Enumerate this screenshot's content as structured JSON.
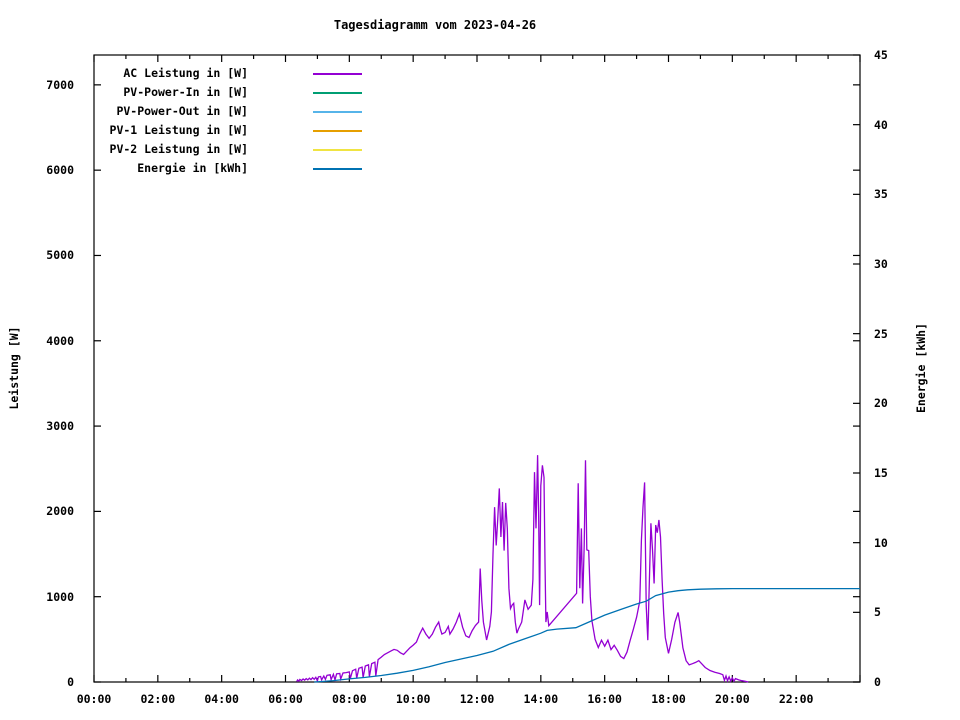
{
  "title": "Tagesdiagramm vom 2023-04-26",
  "chart_data": {
    "type": "line",
    "title": "Tagesdiagramm vom 2023-04-26",
    "grid": false,
    "legend_position": "top-left",
    "x_axis": {
      "unit": "time of day",
      "range_hours": [
        0,
        24
      ],
      "major_tick_every_hours": 2,
      "minor_tick_every_hours": 1,
      "tick_labels": [
        "00:00",
        "02:00",
        "04:00",
        "06:00",
        "08:00",
        "10:00",
        "12:00",
        "14:00",
        "16:00",
        "18:00",
        "20:00",
        "22:00"
      ]
    },
    "y_left_axis": {
      "label": "Leistung [W]",
      "range": [
        0,
        7350
      ],
      "ticks": [
        0,
        1000,
        2000,
        3000,
        4000,
        5000,
        6000,
        7000
      ],
      "tick_labels": [
        "0",
        "1000",
        "2000",
        "3000",
        "4000",
        "5000",
        "6000",
        "7000"
      ]
    },
    "y_right_axis": {
      "label": "Energie [kWh]",
      "range": [
        0,
        45
      ],
      "ticks": [
        0,
        5,
        10,
        15,
        20,
        25,
        30,
        35,
        40,
        45
      ],
      "tick_labels": [
        "0",
        "5",
        "10",
        "15",
        "20",
        "25",
        "30",
        "35",
        "40",
        "45"
      ]
    },
    "series": [
      {
        "name": "AC Leistung in [W]",
        "color": "#9400d3",
        "axis": "left",
        "points": [
          [
            6.35,
            5
          ],
          [
            6.38,
            25
          ],
          [
            6.42,
            10
          ],
          [
            6.45,
            30
          ],
          [
            6.5,
            18
          ],
          [
            6.55,
            35
          ],
          [
            6.6,
            22
          ],
          [
            6.65,
            40
          ],
          [
            6.7,
            25
          ],
          [
            6.75,
            45
          ],
          [
            6.8,
            28
          ],
          [
            6.85,
            50
          ],
          [
            6.9,
            32
          ],
          [
            6.95,
            55
          ],
          [
            7.0,
            15
          ],
          [
            7.03,
            60
          ],
          [
            7.1,
            65
          ],
          [
            7.13,
            25
          ],
          [
            7.2,
            70
          ],
          [
            7.25,
            30
          ],
          [
            7.3,
            78
          ],
          [
            7.4,
            85
          ],
          [
            7.43,
            28
          ],
          [
            7.5,
            90
          ],
          [
            7.55,
            25
          ],
          [
            7.6,
            95
          ],
          [
            7.7,
            100
          ],
          [
            7.73,
            35
          ],
          [
            7.8,
            105
          ],
          [
            7.9,
            110
          ],
          [
            8.0,
            118
          ],
          [
            8.03,
            40
          ],
          [
            8.1,
            132
          ],
          [
            8.2,
            150
          ],
          [
            8.23,
            45
          ],
          [
            8.3,
            162
          ],
          [
            8.4,
            175
          ],
          [
            8.43,
            52
          ],
          [
            8.5,
            188
          ],
          [
            8.6,
            202
          ],
          [
            8.63,
            62
          ],
          [
            8.7,
            216
          ],
          [
            8.8,
            232
          ],
          [
            8.83,
            72
          ],
          [
            8.9,
            262
          ],
          [
            9.0,
            292
          ],
          [
            9.1,
            322
          ],
          [
            9.2,
            342
          ],
          [
            9.3,
            362
          ],
          [
            9.4,
            382
          ],
          [
            9.5,
            372
          ],
          [
            9.6,
            342
          ],
          [
            9.7,
            322
          ],
          [
            9.8,
            362
          ],
          [
            9.9,
            402
          ],
          [
            10.0,
            432
          ],
          [
            10.1,
            468
          ],
          [
            10.2,
            560
          ],
          [
            10.3,
            632
          ],
          [
            10.4,
            562
          ],
          [
            10.5,
            512
          ],
          [
            10.6,
            562
          ],
          [
            10.7,
            642
          ],
          [
            10.8,
            702
          ],
          [
            10.85,
            622
          ],
          [
            10.9,
            562
          ],
          [
            11.0,
            582
          ],
          [
            11.1,
            652
          ],
          [
            11.15,
            562
          ],
          [
            11.25,
            622
          ],
          [
            11.35,
            702
          ],
          [
            11.45,
            800
          ],
          [
            11.55,
            642
          ],
          [
            11.65,
            542
          ],
          [
            11.75,
            522
          ],
          [
            11.85,
            602
          ],
          [
            11.95,
            662
          ],
          [
            12.05,
            702
          ],
          [
            12.1,
            1330
          ],
          [
            12.15,
            952
          ],
          [
            12.2,
            702
          ],
          [
            12.3,
            492
          ],
          [
            12.4,
            652
          ],
          [
            12.45,
            822
          ],
          [
            12.5,
            1500
          ],
          [
            12.55,
            2050
          ],
          [
            12.6,
            1600
          ],
          [
            12.65,
            1900
          ],
          [
            12.7,
            2270
          ],
          [
            12.75,
            1700
          ],
          [
            12.8,
            2110
          ],
          [
            12.85,
            1540
          ],
          [
            12.9,
            2100
          ],
          [
            12.95,
            1800
          ],
          [
            13.0,
            1100
          ],
          [
            13.05,
            862
          ],
          [
            13.1,
            902
          ],
          [
            13.15,
            922
          ],
          [
            13.2,
            702
          ],
          [
            13.25,
            572
          ],
          [
            13.3,
            622
          ],
          [
            13.4,
            702
          ],
          [
            13.5,
            962
          ],
          [
            13.6,
            852
          ],
          [
            13.7,
            902
          ],
          [
            13.75,
            1200
          ],
          [
            13.8,
            2460
          ],
          [
            13.85,
            1800
          ],
          [
            13.9,
            2660
          ],
          [
            13.93,
            2000
          ],
          [
            13.96,
            902
          ],
          [
            14.0,
            2300
          ],
          [
            14.05,
            2540
          ],
          [
            14.1,
            2400
          ],
          [
            14.13,
            1400
          ],
          [
            14.16,
            702
          ],
          [
            14.2,
            822
          ],
          [
            14.25,
            660
          ],
          [
            15.12,
            1040
          ],
          [
            15.17,
            2330
          ],
          [
            15.22,
            1100
          ],
          [
            15.27,
            1800
          ],
          [
            15.31,
            920
          ],
          [
            15.36,
            1600
          ],
          [
            15.4,
            2600
          ],
          [
            15.44,
            1550
          ],
          [
            15.5,
            1540
          ],
          [
            15.55,
            1000
          ],
          [
            15.6,
            720
          ],
          [
            15.7,
            500
          ],
          [
            15.8,
            405
          ],
          [
            15.9,
            490
          ],
          [
            16.0,
            420
          ],
          [
            16.1,
            490
          ],
          [
            16.2,
            380
          ],
          [
            16.3,
            430
          ],
          [
            16.4,
            370
          ],
          [
            16.5,
            300
          ],
          [
            16.6,
            275
          ],
          [
            16.7,
            350
          ],
          [
            16.8,
            490
          ],
          [
            16.9,
            620
          ],
          [
            17.0,
            760
          ],
          [
            17.1,
            950
          ],
          [
            17.15,
            1660
          ],
          [
            17.2,
            2050
          ],
          [
            17.25,
            2340
          ],
          [
            17.3,
            900
          ],
          [
            17.35,
            490
          ],
          [
            17.4,
            1200
          ],
          [
            17.45,
            1860
          ],
          [
            17.5,
            1550
          ],
          [
            17.55,
            1155
          ],
          [
            17.6,
            1840
          ],
          [
            17.65,
            1750
          ],
          [
            17.7,
            1900
          ],
          [
            17.75,
            1700
          ],
          [
            17.8,
            1200
          ],
          [
            17.85,
            800
          ],
          [
            17.9,
            520
          ],
          [
            18.0,
            335
          ],
          [
            18.1,
            500
          ],
          [
            18.2,
            700
          ],
          [
            18.3,
            815
          ],
          [
            18.35,
            700
          ],
          [
            18.45,
            400
          ],
          [
            18.55,
            250
          ],
          [
            18.65,
            200
          ],
          [
            18.75,
            215
          ],
          [
            18.85,
            230
          ],
          [
            18.95,
            250
          ],
          [
            19.05,
            210
          ],
          [
            19.15,
            170
          ],
          [
            19.3,
            135
          ],
          [
            19.45,
            115
          ],
          [
            19.6,
            100
          ],
          [
            19.7,
            85
          ],
          [
            19.75,
            20
          ],
          [
            19.8,
            70
          ],
          [
            19.85,
            15
          ],
          [
            19.9,
            60
          ],
          [
            19.95,
            12
          ],
          [
            20.0,
            50
          ],
          [
            20.05,
            10
          ],
          [
            20.1,
            40
          ],
          [
            20.2,
            25
          ],
          [
            20.3,
            15
          ],
          [
            20.4,
            8
          ],
          [
            20.5,
            0
          ]
        ]
      },
      {
        "name": "PV-Power-In in [W]",
        "color": "#009e73",
        "axis": "left",
        "points": []
      },
      {
        "name": "PV-Power-Out in [W]",
        "color": "#56b4e9",
        "axis": "left",
        "points": []
      },
      {
        "name": "PV-1 Leistung in [W]",
        "color": "#e69f00",
        "axis": "left",
        "points": []
      },
      {
        "name": "PV-2 Leistung in [W]",
        "color": "#f0e442",
        "axis": "left",
        "points": []
      },
      {
        "name": "Energie in [kWh]",
        "color": "#0072b2",
        "axis": "right",
        "points": [
          [
            6.9,
            0
          ],
          [
            7.2,
            0.04
          ],
          [
            7.5,
            0.1
          ],
          [
            8.0,
            0.22
          ],
          [
            8.5,
            0.33
          ],
          [
            9.0,
            0.47
          ],
          [
            9.5,
            0.63
          ],
          [
            10.0,
            0.83
          ],
          [
            10.5,
            1.1
          ],
          [
            11.0,
            1.4
          ],
          [
            11.5,
            1.65
          ],
          [
            12.0,
            1.9
          ],
          [
            12.5,
            2.2
          ],
          [
            13.0,
            2.7
          ],
          [
            13.5,
            3.1
          ],
          [
            14.0,
            3.5
          ],
          [
            14.2,
            3.7
          ],
          [
            14.5,
            3.8
          ],
          [
            15.1,
            3.9
          ],
          [
            15.5,
            4.3
          ],
          [
            16.0,
            4.8
          ],
          [
            16.5,
            5.2
          ],
          [
            17.0,
            5.6
          ],
          [
            17.3,
            5.8
          ],
          [
            17.6,
            6.2
          ],
          [
            18.0,
            6.45
          ],
          [
            18.3,
            6.55
          ],
          [
            18.6,
            6.62
          ],
          [
            19.0,
            6.66
          ],
          [
            19.5,
            6.69
          ],
          [
            20.0,
            6.7
          ],
          [
            24.0,
            6.7
          ]
        ]
      }
    ]
  }
}
